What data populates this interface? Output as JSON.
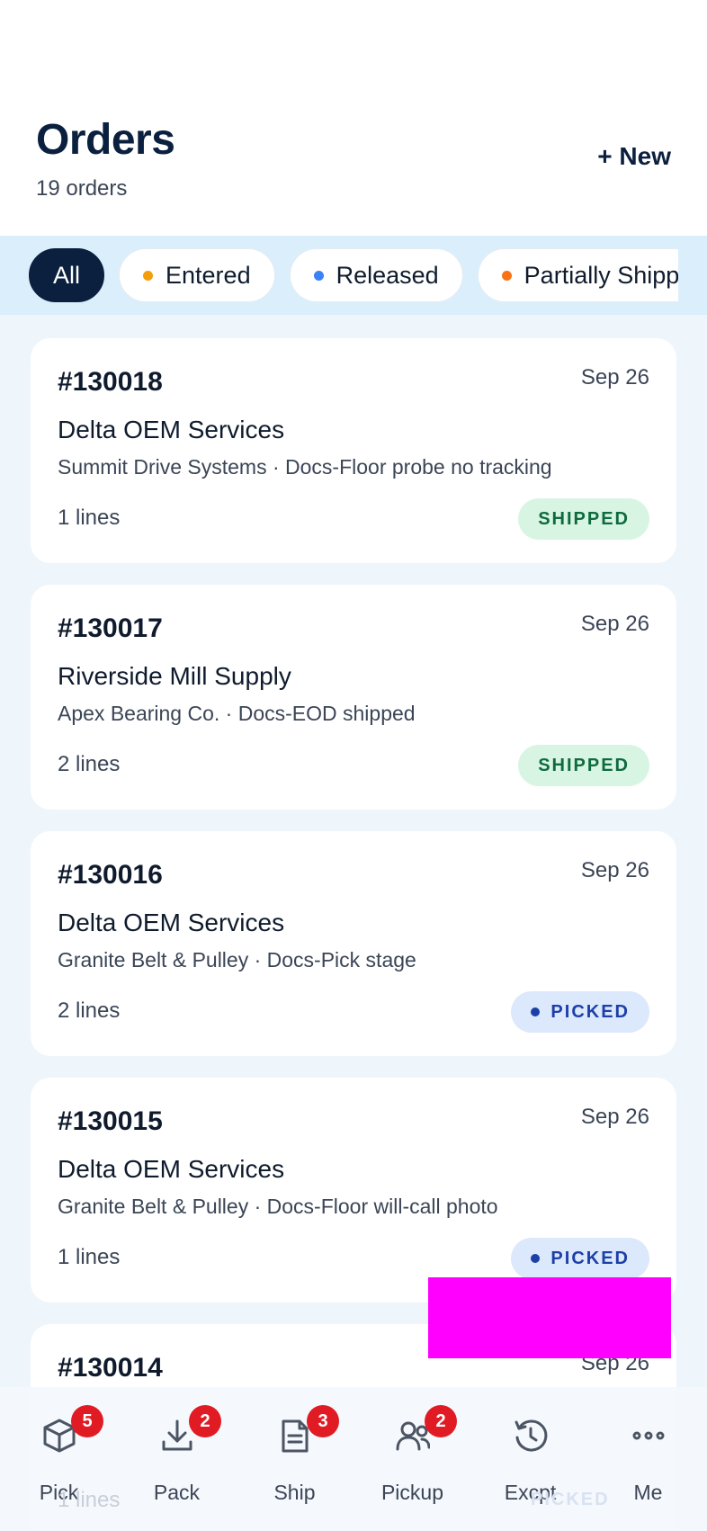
{
  "header": {
    "title": "Orders",
    "count_text": "19 orders",
    "new_label": "+ New"
  },
  "filters": [
    {
      "label": "All",
      "active": true,
      "dot": null
    },
    {
      "label": "Entered",
      "active": false,
      "dot": "#f59e0b"
    },
    {
      "label": "Released",
      "active": false,
      "dot": "#3b82f6"
    },
    {
      "label": "Partially Shipped",
      "active": false,
      "dot": "#f97316"
    }
  ],
  "orders": [
    {
      "number": "#130018",
      "date": "Sep 26",
      "customer": "Delta OEM Services",
      "detail": "Summit Drive Systems · Docs-Floor probe no tracking",
      "lines": "1 lines",
      "status": "SHIPPED"
    },
    {
      "number": "#130017",
      "date": "Sep 26",
      "customer": "Riverside Mill Supply",
      "detail": "Apex Bearing Co. · Docs-EOD shipped",
      "lines": "2 lines",
      "status": "SHIPPED"
    },
    {
      "number": "#130016",
      "date": "Sep 26",
      "customer": "Delta OEM Services",
      "detail": "Granite Belt & Pulley · Docs-Pick stage",
      "lines": "2 lines",
      "status": "PICKED"
    },
    {
      "number": "#130015",
      "date": "Sep 26",
      "customer": "Delta OEM Services",
      "detail": "Granite Belt & Pulley · Docs-Floor will-call photo",
      "lines": "1 lines",
      "status": "PICKED"
    },
    {
      "number": "#130014",
      "date": "Sep 26",
      "customer": "",
      "detail": "",
      "lines": "1 lines",
      "status": "PICKED"
    }
  ],
  "tabs": [
    {
      "label": "Pick",
      "icon": "box-icon",
      "badge": "5"
    },
    {
      "label": "Pack",
      "icon": "download-icon",
      "badge": "2"
    },
    {
      "label": "Ship",
      "icon": "document-icon",
      "badge": "3"
    },
    {
      "label": "Pickup",
      "icon": "users-icon",
      "badge": "2"
    },
    {
      "label": "Excpt",
      "icon": "history-icon",
      "badge": null
    },
    {
      "label": "Me",
      "icon": "more-icon",
      "badge": null
    }
  ],
  "colors": {
    "navy": "#0b1f3f",
    "shipped_bg": "#d8f5e4",
    "shipped_fg": "#0e6b3e",
    "picked_bg": "#dce8fb",
    "picked_fg": "#1d3fa8",
    "badge_red": "#e01b24"
  }
}
